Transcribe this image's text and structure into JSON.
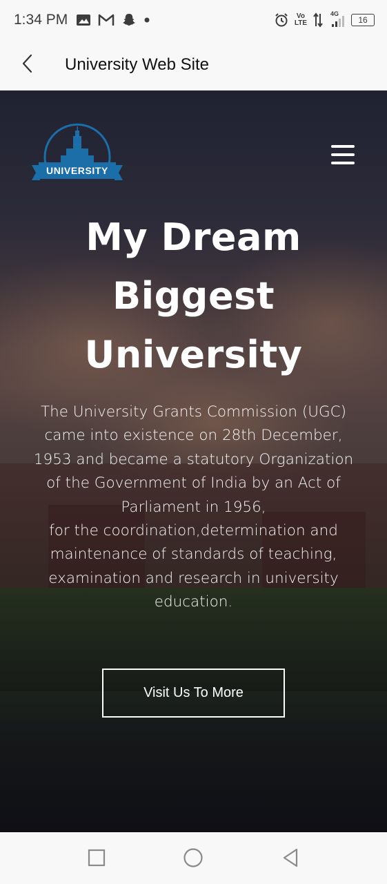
{
  "status_bar": {
    "time": "1:34 PM",
    "left_icons": [
      "image-icon",
      "gmail-icon",
      "snapchat-icon",
      "dot-icon"
    ],
    "right_icons": [
      "alarm-icon",
      "volte-icon",
      "data-arrows-icon",
      "signal-4g-icon",
      "battery-icon"
    ],
    "volte_top": "Vo",
    "volte_bottom": "LTE",
    "network": "4G",
    "battery": "16"
  },
  "app_bar": {
    "title": "University Web Site",
    "back_icon": "chevron-left-icon"
  },
  "hero": {
    "logo_text": "UNIVERSITY",
    "menu_icon": "hamburger-menu-icon",
    "title_lines": [
      "My Dream",
      "Biggest",
      "University"
    ],
    "description_lines": [
      "The University Grants Commission (UGC)",
      "came into existence on 28th December,",
      "1953 and became a statutory Organization",
      "of the Government of India by an Act of",
      "Parliament in 1956,",
      "for the coordination,determination and",
      "maintenance of standards of teaching,",
      "examination and research in university",
      "education."
    ],
    "button_label": "Visit Us To More"
  },
  "nav_bar": {
    "icons": [
      "recent-apps-icon",
      "home-icon",
      "back-icon"
    ]
  },
  "colors": {
    "logo_blue": "#1b6ea8",
    "text_white": "#ffffff",
    "bar_background": "#f8f8f8"
  }
}
